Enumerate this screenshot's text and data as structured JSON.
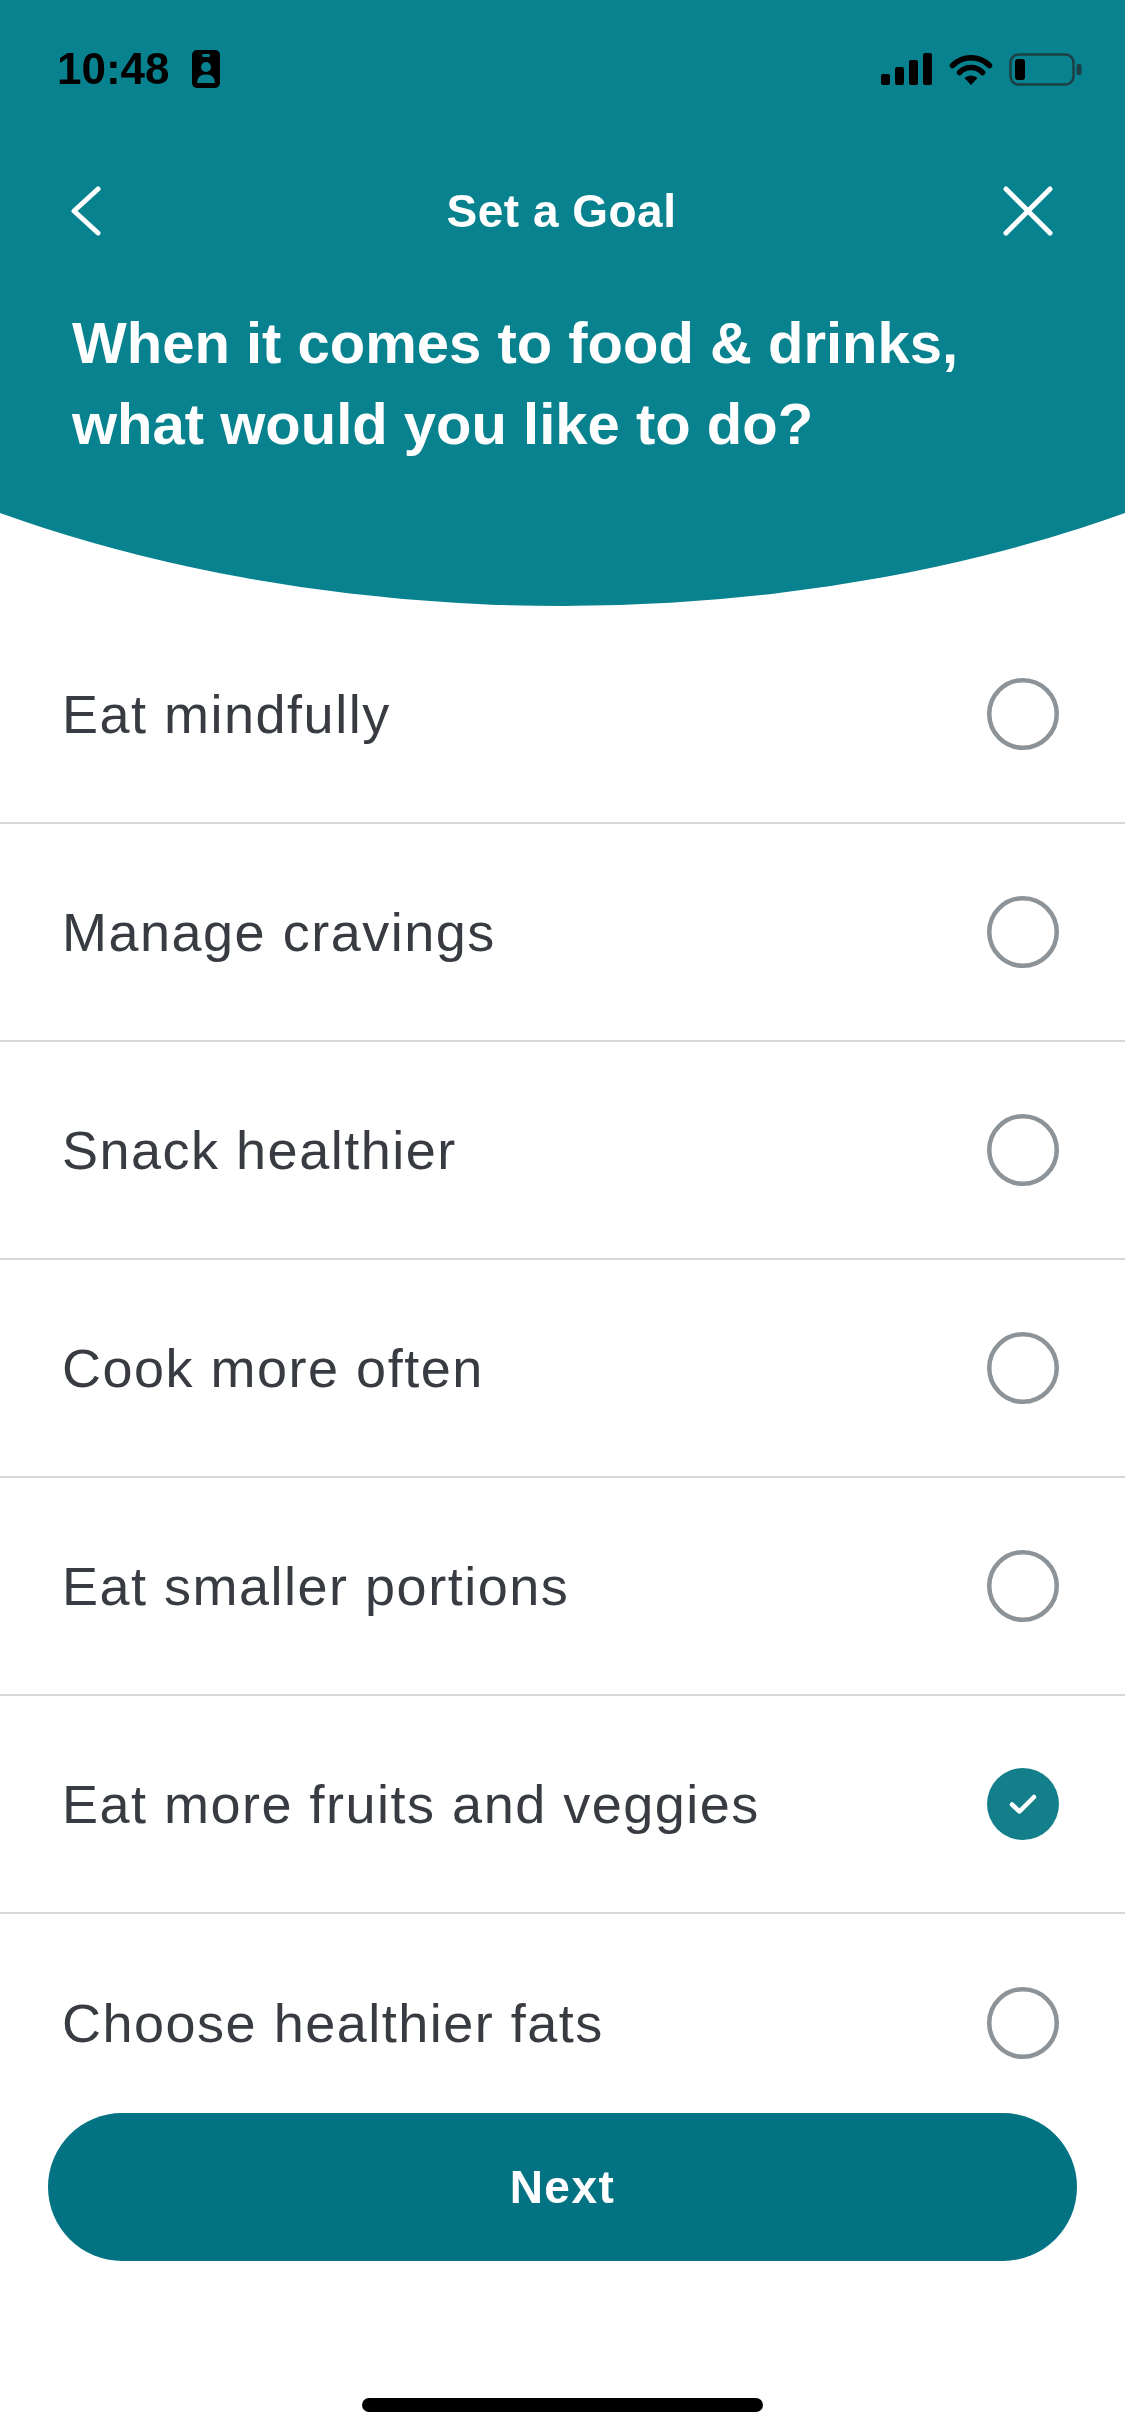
{
  "status_bar": {
    "time": "10:48"
  },
  "header": {
    "title": "Set a Goal",
    "question": "When it comes to food & drinks, what would you like to do?"
  },
  "options": [
    {
      "label": "Eat mindfully",
      "selected": false
    },
    {
      "label": "Manage cravings",
      "selected": false
    },
    {
      "label": "Snack healthier",
      "selected": false
    },
    {
      "label": "Cook more often",
      "selected": false
    },
    {
      "label": "Eat smaller portions",
      "selected": false
    },
    {
      "label": "Eat more fruits and veggies",
      "selected": true
    },
    {
      "label": "Choose healthier fats",
      "selected": false
    }
  ],
  "next_button": {
    "label": "Next"
  }
}
